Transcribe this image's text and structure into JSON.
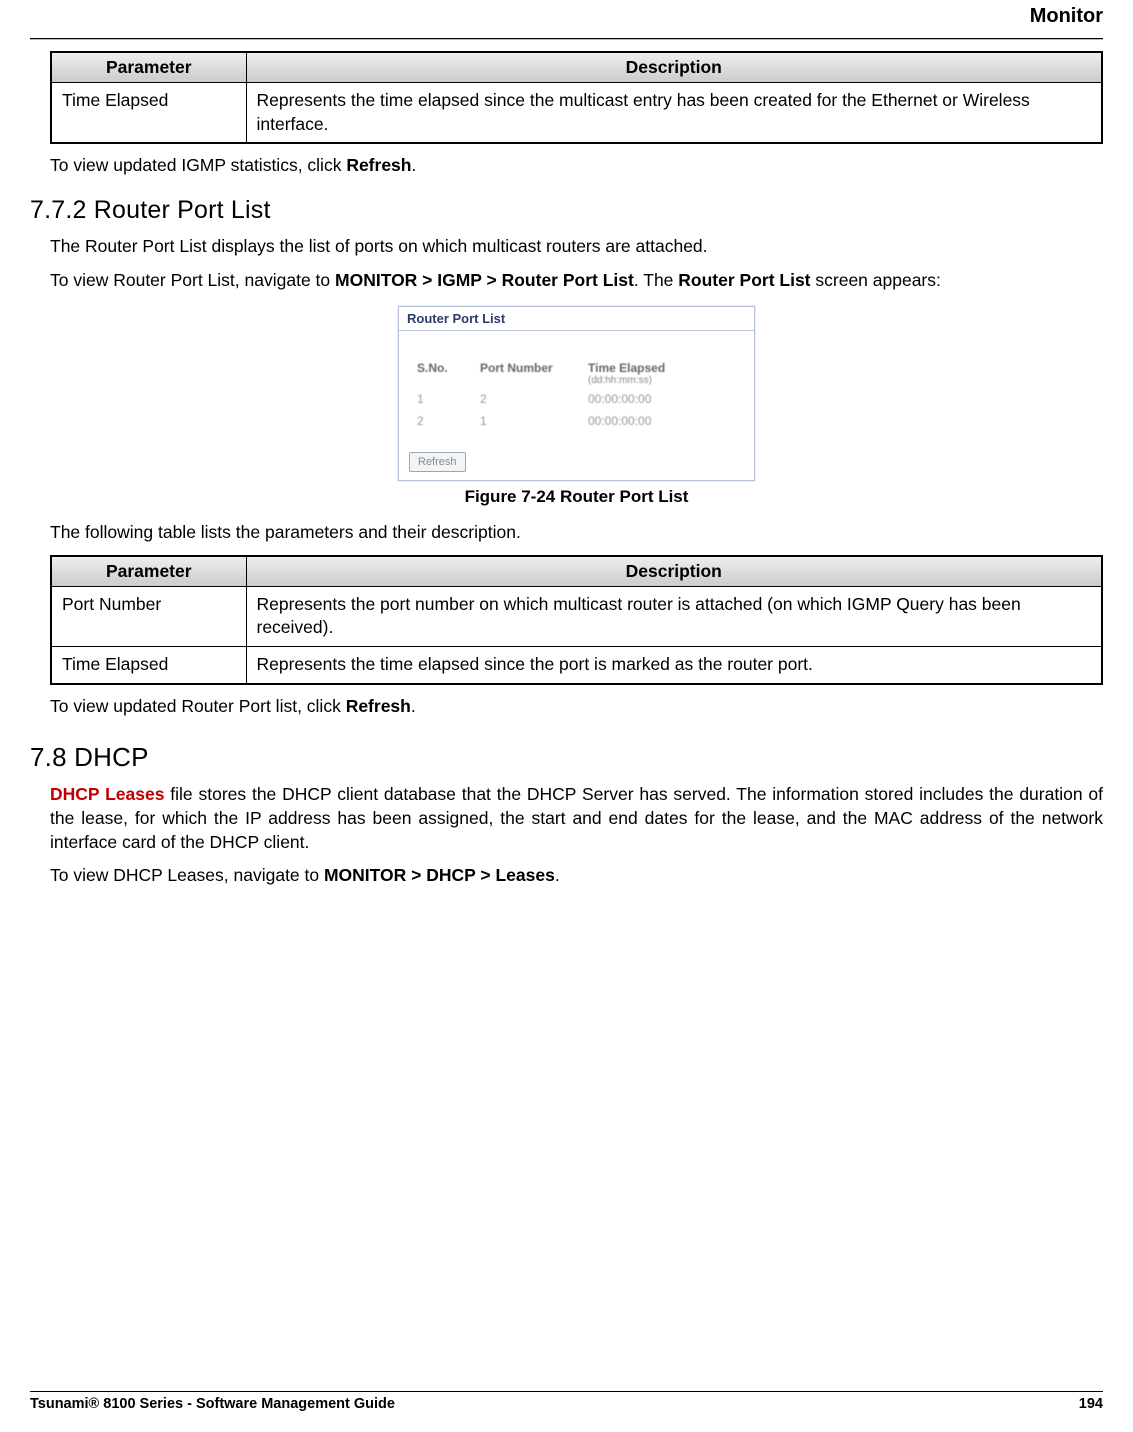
{
  "header": {
    "title": "Monitor"
  },
  "table1": {
    "headers": {
      "param": "Parameter",
      "desc": "Description"
    },
    "rows": [
      {
        "param": "Time Elapsed",
        "desc": "Represents the time elapsed since the multicast entry has been created for the Ethernet or Wireless interface."
      }
    ]
  },
  "p_igmp_refresh_pre": "To view updated IGMP statistics, click ",
  "p_igmp_refresh_bold": "Refresh",
  "p_igmp_refresh_post": ".",
  "h772": "7.7.2 Router Port List",
  "p_router_intro": "The Router Port List displays the list of ports on which multicast routers are attached.",
  "p_router_nav_pre": "To view Router Port List, navigate to ",
  "p_router_nav_bold": "MONITOR > IGMP > Router Port List",
  "p_router_nav_mid": ". The ",
  "p_router_nav_bold2": "Router Port List",
  "p_router_nav_post": " screen appears:",
  "mock": {
    "title": "Router Port List",
    "cols": {
      "sno": "S.No.",
      "port": "Port Number",
      "time": "Time Elapsed",
      "time_sub": "(dd:hh:mm:ss)"
    },
    "rows": [
      {
        "sno": "1",
        "port": "2",
        "time": "00:00:00:00"
      },
      {
        "sno": "2",
        "port": "1",
        "time": "00:00:00:00"
      }
    ],
    "refresh": "Refresh"
  },
  "fig_caption": "Figure 7-24 Router Port List",
  "p_table_intro": "The following table lists the parameters and their description.",
  "table2": {
    "headers": {
      "param": "Parameter",
      "desc": "Description"
    },
    "rows": [
      {
        "param": "Port Number",
        "desc": "Represents the port number on which multicast router is attached (on which IGMP Query has been received)."
      },
      {
        "param": "Time Elapsed",
        "desc": "Represents the time elapsed since the port is marked as the router port."
      }
    ]
  },
  "p_router_refresh_pre": "To view updated Router Port list, click ",
  "p_router_refresh_bold": "Refresh",
  "p_router_refresh_post": ".",
  "h78": "7.8 DHCP",
  "p_dhcp_lead": "DHCP Leases",
  "p_dhcp_body": " file stores the DHCP client database that the DHCP Server has served. The information stored includes the duration of the lease, for which the IP address has been assigned, the start and end dates for the lease, and the MAC address of the network interface card of the DHCP client.",
  "p_dhcp_nav_pre": "To view DHCP Leases, navigate to ",
  "p_dhcp_nav_bold": "MONITOR > DHCP > Leases",
  "p_dhcp_nav_post": ".",
  "footer": {
    "left": "Tsunami® 8100 Series - Software Management Guide",
    "right": "194"
  }
}
